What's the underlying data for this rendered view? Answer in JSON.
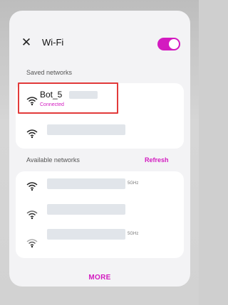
{
  "header": {
    "title": "Wi-Fi",
    "toggle_on": true
  },
  "saved": {
    "label": "Saved networks",
    "networks": [
      {
        "name": "Bot_5",
        "status": "Connected"
      },
      {
        "name": ""
      }
    ]
  },
  "available": {
    "label": "Available networks",
    "refresh_label": "Refresh",
    "networks": [
      {
        "band": "5GHz"
      },
      {
        "band": ""
      },
      {
        "band": "5GHz"
      }
    ]
  },
  "footer": {
    "more_label": "MORE"
  },
  "icons": [
    "close-icon",
    "wifi-icon"
  ],
  "colors": {
    "accent": "#d31ac0",
    "highlight": "#e23a3a",
    "mask": "#e1e5ea"
  }
}
